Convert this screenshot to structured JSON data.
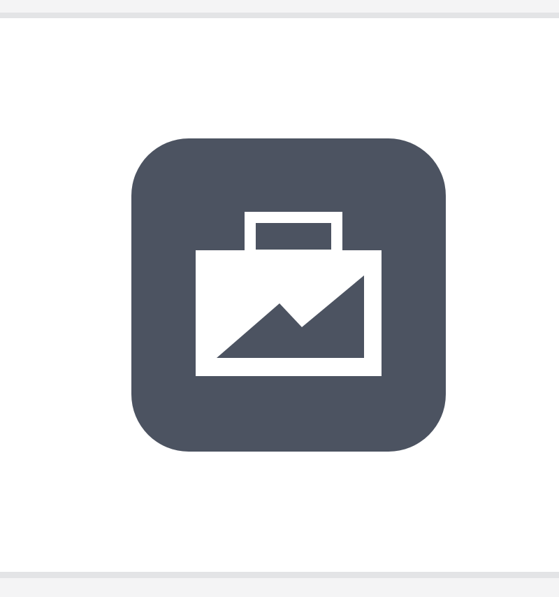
{
  "icon": {
    "name": "briefcase-chart-icon",
    "background_color": "#4c5361",
    "glyph_color": "#ffffff"
  },
  "chrome": {
    "band_color": "#f4f4f5",
    "divider_color": "#e3e4e6"
  }
}
